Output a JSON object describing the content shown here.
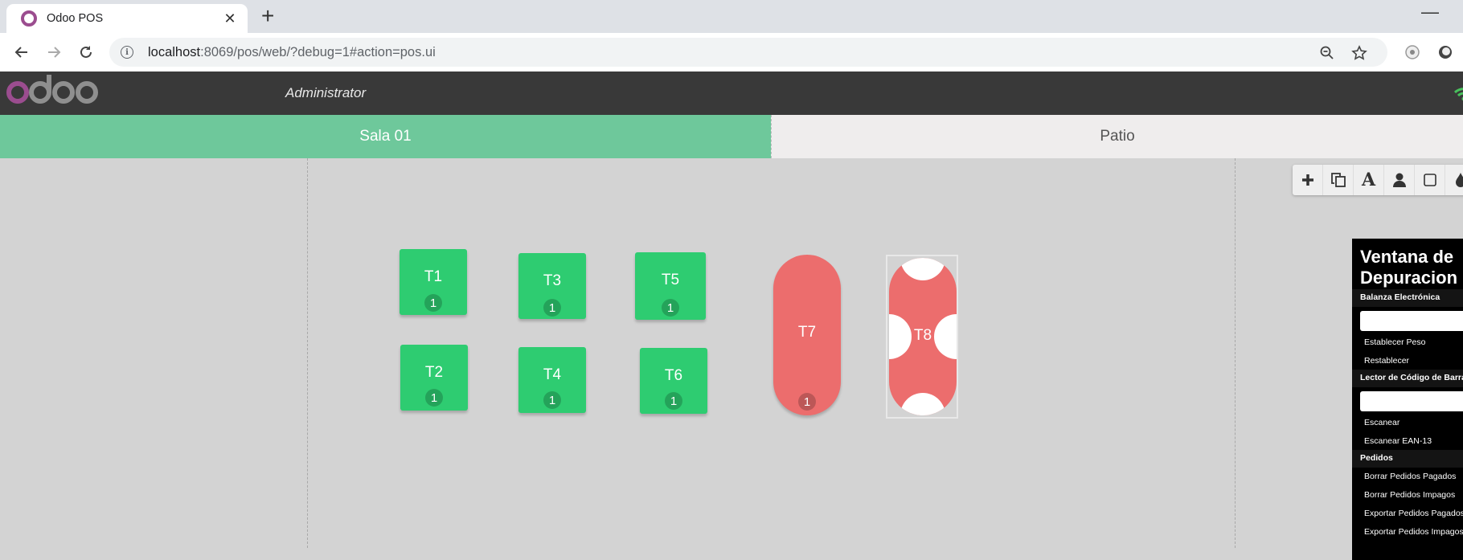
{
  "browser": {
    "tab_title": "Odoo POS",
    "url_host": "localhost",
    "url_rest": ":8069/pos/web/?debug=1#action=pos.ui",
    "icons": [
      "favicon-icon",
      "close-icon",
      "new-tab-icon",
      "back-icon",
      "forward-icon",
      "reload-icon",
      "site-info-icon",
      "zoom-out-icon",
      "bookmark-star-icon",
      "extension-icon",
      "profile-icon",
      "minimize-icon"
    ]
  },
  "pos": {
    "logo_text": "odoo",
    "cashier": "Administrator",
    "brand_color": "#9b4d8f",
    "connection_icon": "wifi-icon"
  },
  "floors": [
    {
      "name": "Sala 01",
      "active": true
    },
    {
      "name": "Patio",
      "active": false
    }
  ],
  "tables": [
    {
      "name": "T1",
      "guests": "1",
      "status": "free"
    },
    {
      "name": "T3",
      "guests": "1",
      "status": "free"
    },
    {
      "name": "T5",
      "guests": "1",
      "status": "free"
    },
    {
      "name": "T2",
      "guests": "1",
      "status": "free"
    },
    {
      "name": "T4",
      "guests": "1",
      "status": "free"
    },
    {
      "name": "T6",
      "guests": "1",
      "status": "free"
    },
    {
      "name": "T7",
      "guests": "1",
      "status": "round"
    },
    {
      "name": "T8",
      "guests": "",
      "status": "selected"
    }
  ],
  "colors": {
    "green_table": "#2ecc71",
    "red_table": "#ec6d6d",
    "active_floor": "#6ec89b"
  },
  "edit_toolbar": [
    "plus-icon",
    "copy-icon",
    "rename-text-icon",
    "seats-person-icon",
    "shape-square-icon",
    "color-drop-icon"
  ],
  "debug": {
    "title": "Ventana de Depuracion",
    "scale_section": "Balanza Electrónica",
    "set_weight": "Establecer Peso",
    "reset": "Restablecer",
    "barcode_section": "Lector de Código de Barras",
    "scan": "Escanear",
    "scan_ean": "Escanear EAN-13",
    "orders_section": "Pedidos",
    "delete_paid": "Borrar Pedidos Pagados",
    "delete_unpaid": "Borrar Pedidos Impagos",
    "export_paid": "Exportar Pedidos Pagados",
    "export_unpaid": "Exportar Pedidos Impagos"
  }
}
